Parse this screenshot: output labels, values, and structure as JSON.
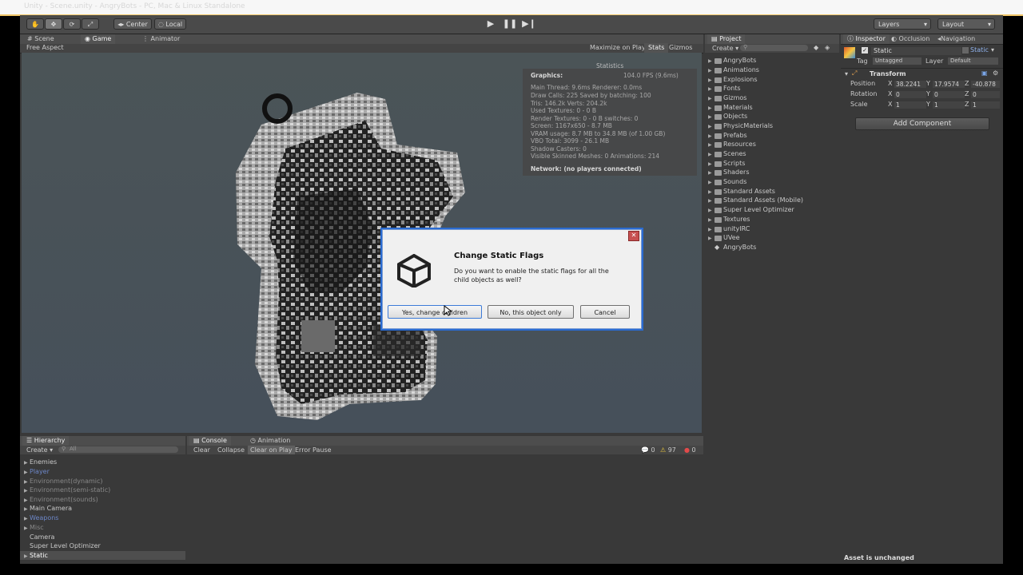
{
  "window": {
    "title": "Unity - Scene.unity - AngryBots - PC, Mac & Linux Standalone"
  },
  "toolbar": {
    "pivot_label": "Center",
    "space_label": "Local",
    "layers_label": "Layers",
    "layout_label": "Layout"
  },
  "scene_tabs": {
    "scene": "Scene",
    "game": "Game",
    "animator": "Animator"
  },
  "game_bar": {
    "aspect": "Free Aspect",
    "maximize": "Maximize on Play",
    "stats": "Stats",
    "gizmos": "Gizmos"
  },
  "stats": {
    "header": "Statistics",
    "graphics_label": "Graphics:",
    "fps": "104.0 FPS (9.6ms)",
    "lines": [
      "Main Thread: 9.6ms  Renderer: 0.0ms",
      "Draw Calls: 225   Saved by batching: 100",
      "Tris: 146.2k     Verts: 204.2k",
      "Used Textures: 0 - 0 B",
      "Render Textures: 0 - 0 B   switches: 0",
      "Screen: 1167x650 - 8.7 MB",
      "VRAM usage: 8.7 MB to 34.8 MB (of 1.00 GB)",
      "VBO Total: 3099 - 26.1 MB",
      "Shadow Casters: 0",
      "Visible Skinned Meshes: 0      Animations: 214"
    ],
    "network": "Network: (no players connected)"
  },
  "dialog": {
    "title": "Change Static Flags",
    "message": "Do you want to enable the static flags for all the child objects as well?",
    "yes": "Yes, change children",
    "no": "No, this object only",
    "cancel": "Cancel"
  },
  "hierarchy": {
    "tab": "Hierarchy",
    "create": "Create",
    "search_placeholder": "All",
    "items": [
      {
        "label": "Enemies"
      },
      {
        "label": "Player"
      },
      {
        "label": "Environment(dynamic)"
      },
      {
        "label": "Environment(semi-static)"
      },
      {
        "label": "Environment(sounds)"
      },
      {
        "label": "Main Camera"
      },
      {
        "label": "Weapons"
      },
      {
        "label": "Misc"
      },
      {
        "label": "Camera"
      },
      {
        "label": "Super Level Optimizer"
      },
      {
        "label": "Static"
      }
    ]
  },
  "console": {
    "tab": "Console",
    "animation_tab": "Animation",
    "clear": "Clear",
    "collapse": "Collapse",
    "clear_on_play": "Clear on Play",
    "error_pause": "Error Pause",
    "info_count": "0",
    "warn_count": "97",
    "error_count": "0"
  },
  "project": {
    "tab": "Project",
    "create": "Create",
    "items": [
      "AngryBots",
      "Animations",
      "Explosions",
      "Fonts",
      "Gizmos",
      "Materials",
      "Objects",
      "PhysicMaterials",
      "Prefabs",
      "Resources",
      "Scenes",
      "Scripts",
      "Shaders",
      "Sounds",
      "Standard Assets",
      "Standard Assets (Mobile)",
      "Super Level Optimizer",
      "Textures",
      "unityIRC",
      "UVee"
    ],
    "scene_item": "AngryBots"
  },
  "inspector": {
    "tabs": {
      "inspector": "Inspector",
      "occlusion": "Occlusion",
      "navigation": "Navigation"
    },
    "object_name": "Static",
    "static_label": "Static",
    "tag_label": "Tag",
    "tag_value": "Untagged",
    "layer_label": "Layer",
    "layer_value": "Default",
    "transform_title": "Transform",
    "position_label": "Position",
    "rotation_label": "Rotation",
    "scale_label": "Scale",
    "axes": {
      "x": "X",
      "y": "Y",
      "z": "Z"
    },
    "position": {
      "x": "38.2241",
      "y": "17.9574",
      "z": "-40.878"
    },
    "rotation": {
      "x": "0",
      "y": "0",
      "z": "0"
    },
    "scale": {
      "x": "1",
      "y": "1",
      "z": "1"
    },
    "add_component": "Add Component"
  },
  "status_bar": {
    "text": "Asset is unchanged"
  },
  "colors": {
    "panel": "#393939",
    "toolbar": "#4a4a4a",
    "dialog": "#f0f0f0",
    "highlight": "#2a6bd1"
  }
}
